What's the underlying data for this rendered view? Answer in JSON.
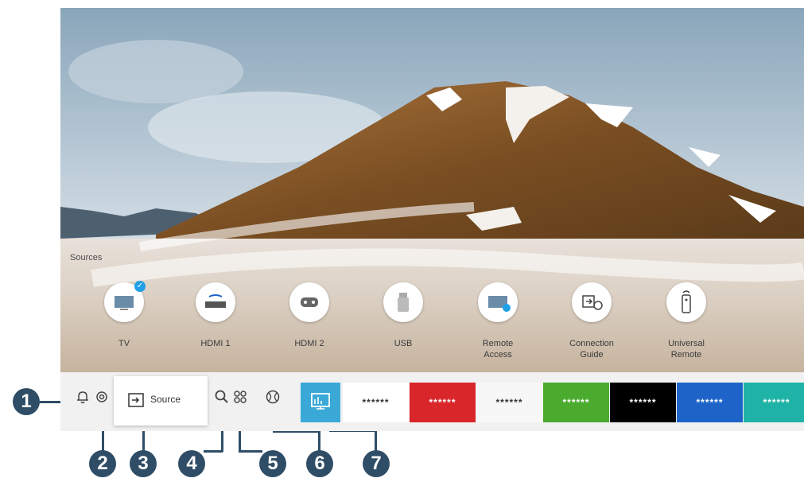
{
  "sources": {
    "title": "Sources",
    "items": [
      {
        "label": "TV",
        "icon": "tv-icon",
        "selected": true
      },
      {
        "label": "HDMI 1",
        "icon": "bluray-player-icon"
      },
      {
        "label": "HDMI 2",
        "icon": "game-console-icon"
      },
      {
        "label": "USB",
        "icon": "usb-icon"
      },
      {
        "label": "Remote\nAccess",
        "icon": "remote-access-icon"
      },
      {
        "label": "Connection\nGuide",
        "icon": "connection-guide-icon"
      },
      {
        "label": "Universal\nRemote",
        "icon": "universal-remote-icon"
      }
    ]
  },
  "bottom_bar": {
    "source_label": "Source",
    "apps": [
      {
        "label": "******",
        "bg": "#ffffff",
        "fg": "#333333"
      },
      {
        "label": "******",
        "bg": "#d9262b",
        "fg": "#ffffff"
      },
      {
        "label": "******",
        "bg": "#f7f7f7",
        "fg": "#333333"
      },
      {
        "label": "******",
        "bg": "#4aab2e",
        "fg": "#ffffff"
      },
      {
        "label": "******",
        "bg": "#000000",
        "fg": "#ffffff"
      },
      {
        "label": "******",
        "bg": "#1e64c8",
        "fg": "#ffffff"
      },
      {
        "label": "******",
        "bg": "#1fb3a7",
        "fg": "#ffffff"
      }
    ],
    "featured_color": "#3aa9d8"
  },
  "callouts": [
    "1",
    "2",
    "3",
    "4",
    "5",
    "6",
    "7"
  ],
  "colors": {
    "callout": "#2f4d66",
    "accent": "#1fa0e8"
  }
}
